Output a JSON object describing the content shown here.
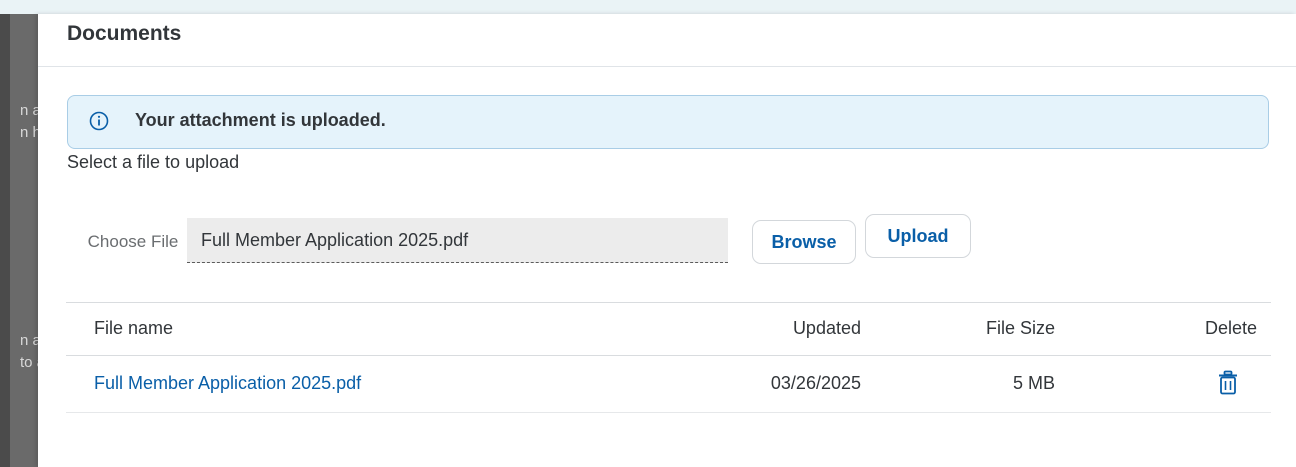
{
  "dialog": {
    "title": "Documents"
  },
  "message": {
    "text": "Your attachment is uploaded.",
    "icon": "info-icon",
    "color": "#e5f3fb"
  },
  "upload": {
    "instruction": "Select a file to upload",
    "choose_label": "Choose File",
    "file_value": "Full Member Application 2025.pdf",
    "browse_label": "Browse",
    "upload_label": "Upload"
  },
  "table": {
    "headers": {
      "name": "File name",
      "updated": "Updated",
      "size": "File Size",
      "delete": "Delete"
    },
    "rows": [
      {
        "name": "Full Member Application 2025.pdf",
        "updated": "03/26/2025",
        "size": "5 MB",
        "delete_icon": "trash-icon"
      }
    ]
  },
  "background": {
    "peek_lines": [
      "n a",
      "n h",
      "n a",
      "to a"
    ]
  },
  "colors": {
    "link": "#0a5fa8",
    "text": "#32363a"
  }
}
